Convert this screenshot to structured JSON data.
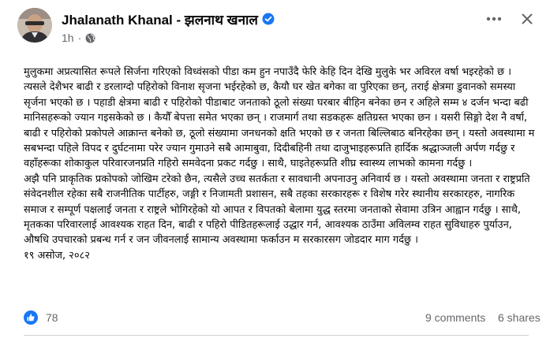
{
  "post": {
    "author": "Jhalanath Khanal - झलनाथ खनाल",
    "time": "1h",
    "separator": "·",
    "body": [
      "मुलुकमा अप्रत्यासित रूपले सिर्जना गरिएको विध्वंसको पीडा कम हुन नपाउँदै फेरि केहि दिन देखि मुलुके भर अविरल वर्षा भइरहेको छ । त्यसले देशैभर बाढी र डरलाग्दो पहिरोको विनाश सृजना भईरहेको छ, कैयौ घर खेत बगेका वा पुरिएका छन्, तराई क्षेत्रमा डुवानको समस्या सृर्जना भएको छ । पहाडी क्षेत्रमा बाढी र पहिरोको पीडाबाट जनताको ठूलो संख्या घरबार बीहिन बनेका छन र अहिले सम्म ४ दर्जन भन्दा बढी मानिसहरूको ज्यान गइसकेको छ । कैयौँ बेपत्ता समेत भएका छन् । राजमार्ग तथा सडकहरू क्षतिग्रस्त भएका छन । यसरी सिङ्गो देश नै वर्षा, बाढी र पहिरोको प्रकोपले आक्रान्त बनेको छ, ठूलो संख्यामा जनधनको क्षति भएको छ र जनता बिल्लिबाठ बनिरहेका छन् । यस्तो अवस्थामा म सबभन्दा पहिले विपद र दुर्घटनामा परेर ज्यान गुमाउने सबै आमाबुवा, दिदीबहिनी तथा दाजुभाइहरूप्रति हार्दिक श्रद्धाञ्जली अर्पण गर्दछु र वहाँहरूका शोकाकुल परिवारजनप्रति गहिरो समवेदना प्रकट गर्दछु । साथै, घाइतेहरूप्रति शीघ्र स्वास्थ्य लाभको कामना गर्दछु ।",
      "अझै पनि प्राकृतिक प्रकोपको जोखिम टरेको छैन, त्यसैले उच्च सतर्कता र सावधानी अपनाउनु अनिवार्य छ । यस्तो अवस्थामा जनता र राष्ट्रप्रति संवेदनशील रहेका सबै राजनीतिक पार्टीहरु, जङ्गी र निजामती प्रशासन, सबै तहका सरकारहरू र विशेष गरेर स्थानीय सरकारहरु, नागरिक समाज र सम्पूर्ण पक्षलाई जनता र राष्ट्रले भोगिरहेको यो आपत र विपतको बेलामा युद्ध स्तरमा जनताको सेवामा उत्रिन आह्वान गर्दछु । साथै, मृतकका परिवारलाई आवश्यक राहत दिन, बाढी र पहिरो पीडितहरूलाई उद्धार गर्न, आवश्यक ठाउँमा अविलम्व राहत सुविधाहरु पुर्याउन, औषधि उपचारको प्रबन्ध गर्न र जन जीवनलाई सामान्य अवस्थामा फर्काउन म सरकारसग जोडदार माग गर्दछु ।",
      "१९ असोज, २०८२"
    ]
  },
  "stats": {
    "reactions": "78",
    "comments": "9 comments",
    "shares": "6 shares"
  },
  "icons": {
    "verified": "verified-badge-icon",
    "privacy": "globe-icon",
    "more": "more-options-icon",
    "close": "close-icon",
    "like": "like-reaction-icon"
  },
  "colors": {
    "accent": "#1877f2",
    "secondary_text": "#65676b",
    "primary_text": "#050505"
  }
}
